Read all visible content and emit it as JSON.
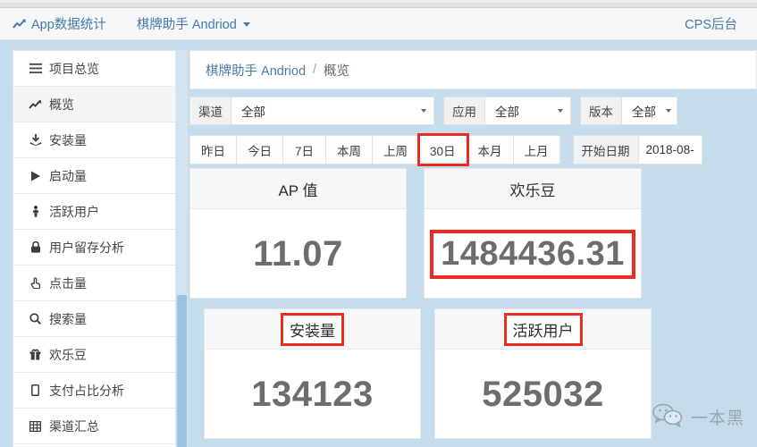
{
  "header": {
    "brand_icon": "line-chart-icon",
    "brand_label": "App数据统计",
    "app_selector": "棋牌助手 Andriod",
    "right_link": "CPS后台"
  },
  "sidebar": {
    "items": [
      {
        "icon": "hamburger-icon",
        "label": "项目总览",
        "active": false
      },
      {
        "icon": "line-chart-icon",
        "label": "概览",
        "active": true
      },
      {
        "icon": "download-icon",
        "label": "安装量",
        "active": false
      },
      {
        "icon": "play-icon",
        "label": "启动量",
        "active": false
      },
      {
        "icon": "person-icon",
        "label": "活跃用户",
        "active": false
      },
      {
        "icon": "lock-icon",
        "label": "用户留存分析",
        "active": false
      },
      {
        "icon": "hand-click-icon",
        "label": "点击量",
        "active": false
      },
      {
        "icon": "search-icon",
        "label": "搜索量",
        "active": false
      },
      {
        "icon": "gift-icon",
        "label": "欢乐豆",
        "active": false
      },
      {
        "icon": "mobile-icon",
        "label": "支付占比分析",
        "active": false
      },
      {
        "icon": "grid-table-icon",
        "label": "渠道汇总",
        "active": false
      }
    ]
  },
  "breadcrumb": {
    "root": "棋牌助手 Andriod",
    "separator": "/",
    "current": "概览"
  },
  "filters": [
    {
      "name": "channel",
      "label": "渠道",
      "value": "全部"
    },
    {
      "name": "app",
      "label": "应用",
      "value": "全部"
    },
    {
      "name": "version",
      "label": "版本",
      "value": "全部"
    }
  ],
  "date_range": {
    "buttons": [
      {
        "label": "昨日",
        "highlighted": false
      },
      {
        "label": "今日",
        "highlighted": false
      },
      {
        "label": "7日",
        "highlighted": false
      },
      {
        "label": "本周",
        "highlighted": false
      },
      {
        "label": "上周",
        "highlighted": false
      },
      {
        "label": "30日",
        "highlighted": true
      },
      {
        "label": "本月",
        "highlighted": false
      },
      {
        "label": "上月",
        "highlighted": false
      }
    ],
    "start_label": "开始日期",
    "start_value": "2018-08-"
  },
  "cards": [
    {
      "name": "ap-value",
      "title": "AP 值",
      "value": "11.07",
      "title_boxed": false,
      "value_boxed": false
    },
    {
      "name": "happy-beans",
      "title": "欢乐豆",
      "value": "1484436.31",
      "title_boxed": false,
      "value_boxed": true
    },
    {
      "name": "install-count",
      "title": "安装量",
      "value": "134123",
      "title_boxed": true,
      "value_boxed": false
    },
    {
      "name": "active-users",
      "title": "活跃用户",
      "value": "525032",
      "title_boxed": true,
      "value_boxed": false
    }
  ],
  "watermark": {
    "icon": "wechat-icon",
    "text": "一本黑"
  },
  "colors": {
    "page_background": "#c5dcec",
    "accent_blue": "#4878a8",
    "highlight_red": "#ee2b22",
    "card_value_gray": "#6d6d6d"
  }
}
